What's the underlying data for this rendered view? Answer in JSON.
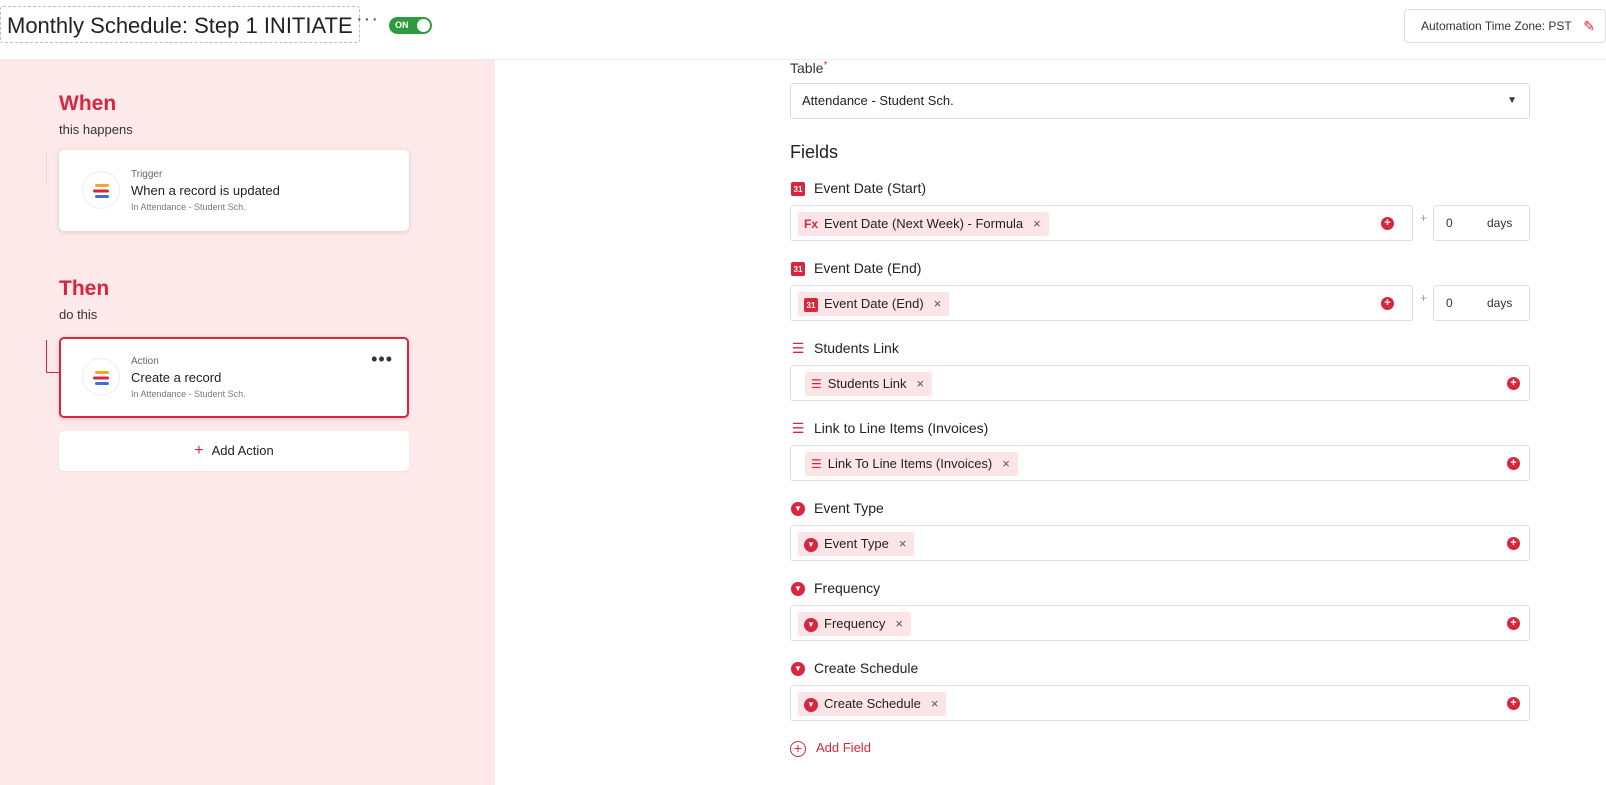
{
  "header": {
    "title": "Monthly Schedule: Step 1 INITIATE",
    "more_icon": "more-horizontal-icon",
    "toggle_label": "ON",
    "timezone_label": "Automation Time Zone: PST",
    "colors": {
      "accent": "#d7263d",
      "toggle_on": "#2e9b3e",
      "left_panel_bg": "#fde8ea"
    }
  },
  "flow": {
    "when_title": "When",
    "when_sub": "this happens",
    "trigger": {
      "kind": "Trigger",
      "name": "When a record is updated",
      "sub": "In Attendance - Student Sch."
    },
    "then_title": "Then",
    "then_sub": "do this",
    "action": {
      "kind": "Action",
      "name": "Create a record",
      "sub": "In Attendance - Student Sch."
    },
    "add_action": "Add Action"
  },
  "form": {
    "table_label": "Table",
    "table_required": "*",
    "table_value": "Attendance - Student Sch.",
    "fields_heading": "Fields",
    "fields": [
      {
        "label": "Event Date (Start)",
        "icon": "calendar-icon",
        "chip": "Event Date (Next Week) - Formula",
        "chip_icon": "Fx",
        "days": "0",
        "days_unit": "days"
      },
      {
        "label": "Event Date (End)",
        "icon": "calendar-icon",
        "chip": "Event Date (End)",
        "chip_icon": "calendar-icon",
        "days": "0",
        "days_unit": "days"
      },
      {
        "label": "Students Link",
        "icon": "link-list-icon",
        "chip": "Students Link",
        "chip_icon": "link-list-icon"
      },
      {
        "label": "Link to Line Items (Invoices)",
        "icon": "link-list-icon",
        "chip": "Link To Line Items (Invoices)",
        "chip_icon": "link-list-icon"
      },
      {
        "label": "Event Type",
        "icon": "single-select-icon",
        "chip": "Event Type",
        "chip_icon": "single-select-icon"
      },
      {
        "label": "Frequency",
        "icon": "single-select-icon",
        "chip": "Frequency",
        "chip_icon": "single-select-icon"
      },
      {
        "label": "Create Schedule",
        "icon": "single-select-icon",
        "chip": "Create Schedule",
        "chip_icon": "single-select-icon"
      }
    ],
    "plus_sep": "+",
    "add_field": "Add Field"
  }
}
